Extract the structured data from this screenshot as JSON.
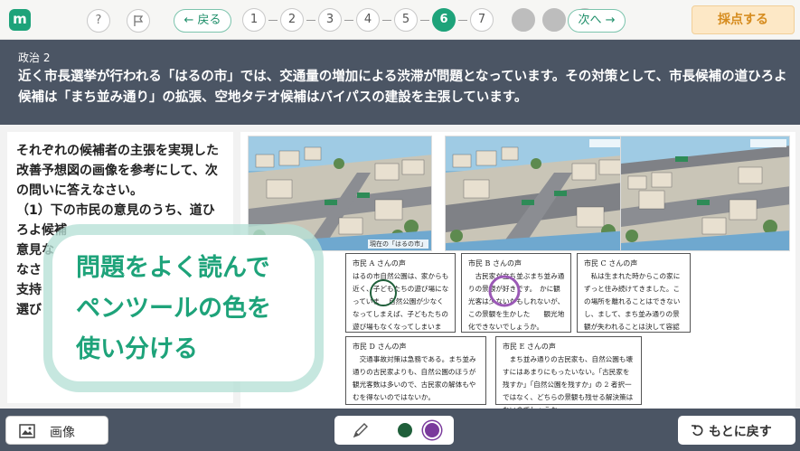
{
  "topbar": {
    "logo": "m",
    "help": "?",
    "back_label": "← 戻る",
    "next_label": "次へ →",
    "pages": [
      "1",
      "2",
      "3",
      "4",
      "5",
      "6",
      "7"
    ],
    "active_page": "6",
    "score_label": "採点する"
  },
  "question": {
    "label": "政治 2",
    "text": "近く市長選挙が行われる「はるの市」では、交通量の増加による渋滞が問題となっています。その対策として、市長候補の道ひろよ候補は「まち並み通り」の拡張、空地タテオ候補はバイパスの建設を主張しています。"
  },
  "left": {
    "text": "それぞれの候補者の主張を実現した改善予想図の画像を参考にして、次の問いに答えなさい。\n（1）下の市民の意見のうち、道ひろよ候補\n意見な\nなさ\n支持\n選び"
  },
  "maps": {
    "caption": "現在の「はるの市」"
  },
  "voices": [
    {
      "title": "市民 A さんの声",
      "body": "はるの市自然公園は、家からも近く、子どもたちの遊び場になっていま　 自然公園が少なくなってしまえば、子どもたちの遊び場もなくなってしまいます。"
    },
    {
      "title": "市民 B さんの声",
      "body": "　古民家が立ち並ぶまち並み通りの景観が好きです。　かに観光客は少ないかもしれないが、この景観を生かした　　観光地化できないでしょうか。"
    },
    {
      "title": "市民 C さんの声",
      "body": "　私は生まれた時からこの家にずっと住み続けてきました。この場所を離れることはできないし、まして、まち並み通りの景観が失われることは決して容認できません。"
    },
    {
      "title": "市民 D さんの声",
      "body": "　交通事故対策は急務である。まち並み通りの古民家よりも、自然公園のほうが観光客数は多いので、古民家の解体もやむを得ないのではないか。"
    },
    {
      "title": "市民 E さんの声",
      "body": "　まち並み通りの古民家も、自然公園も壊すにはあまりにもったいない。「古民家を残すか」「自然公園を残すか」の 2 者択一ではなく、どちらの景観も残せる解決策はないのでしょうか。"
    }
  ],
  "tip": {
    "text": "問題をよく読んで\nペンツールの色を\n使い分ける"
  },
  "bottombar": {
    "image_label": "画像",
    "undo_label": "もとに戻す"
  },
  "colors": {
    "accent": "#1ea37a",
    "header_bg": "#4b5564",
    "pen_green": "#1f5f3a",
    "pen_purple": "#7a3a9c",
    "marker": "#9b59b6"
  }
}
